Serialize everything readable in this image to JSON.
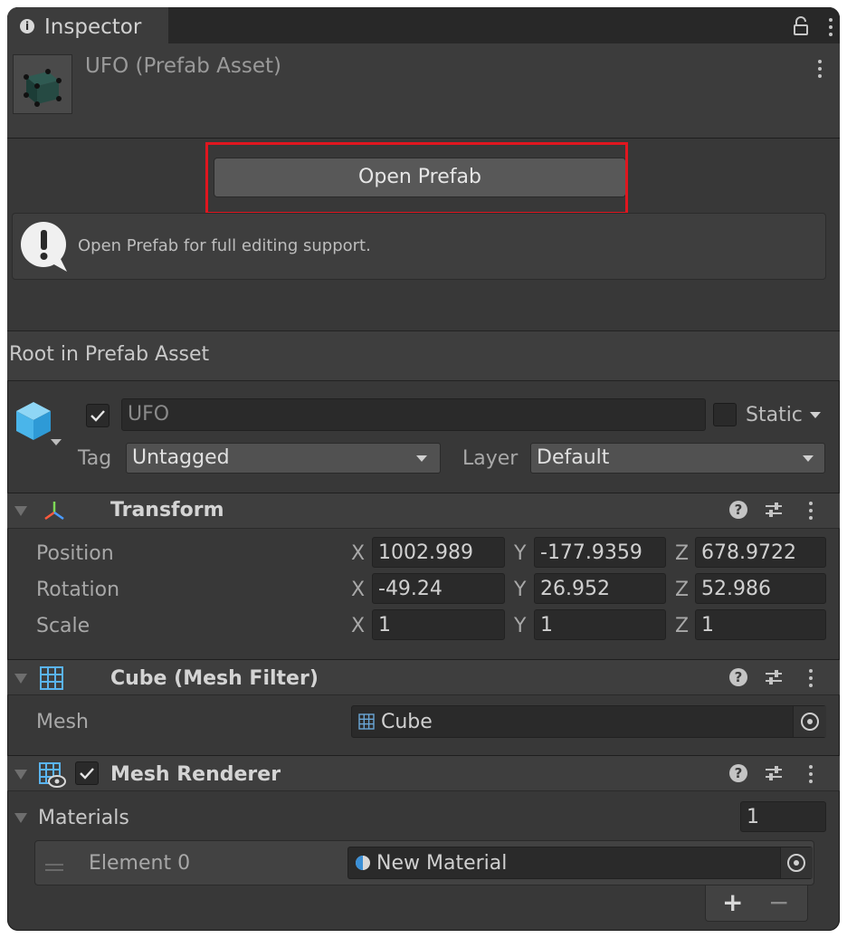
{
  "window": {
    "tab_title": "Inspector",
    "tab_icon": "info-icon"
  },
  "header": {
    "title": "UFO (Prefab Asset)"
  },
  "prefab": {
    "open_button": "Open Prefab",
    "help_text": "Open Prefab for full editing support."
  },
  "root_label": "Root in Prefab Asset",
  "gameobject": {
    "active": true,
    "name": "UFO",
    "static_label": "Static",
    "static_checked": false,
    "tag_label": "Tag",
    "tag_value": "Untagged",
    "layer_label": "Layer",
    "layer_value": "Default"
  },
  "transform": {
    "title": "Transform",
    "rows": [
      {
        "label": "Position",
        "x": "1002.989",
        "y": "-177.9359",
        "z": "678.9722"
      },
      {
        "label": "Rotation",
        "x": "-49.24",
        "y": "26.952",
        "z": "52.986"
      },
      {
        "label": "Scale",
        "x": "1",
        "y": "1",
        "z": "1"
      }
    ],
    "axis_x": "X",
    "axis_y": "Y",
    "axis_z": "Z"
  },
  "mesh_filter": {
    "title": "Cube (Mesh Filter)",
    "mesh_label": "Mesh",
    "mesh_value": "Cube"
  },
  "mesh_renderer": {
    "title": "Mesh Renderer",
    "enabled": true,
    "materials_label": "Materials",
    "materials_count": "1",
    "elements": [
      {
        "label": "Element 0",
        "value": "New Material"
      }
    ],
    "add_label": "+",
    "remove_label": "−"
  },
  "colors": {
    "highlight": "#e0161f",
    "panel": "#383838",
    "field": "#2a2a2a"
  }
}
